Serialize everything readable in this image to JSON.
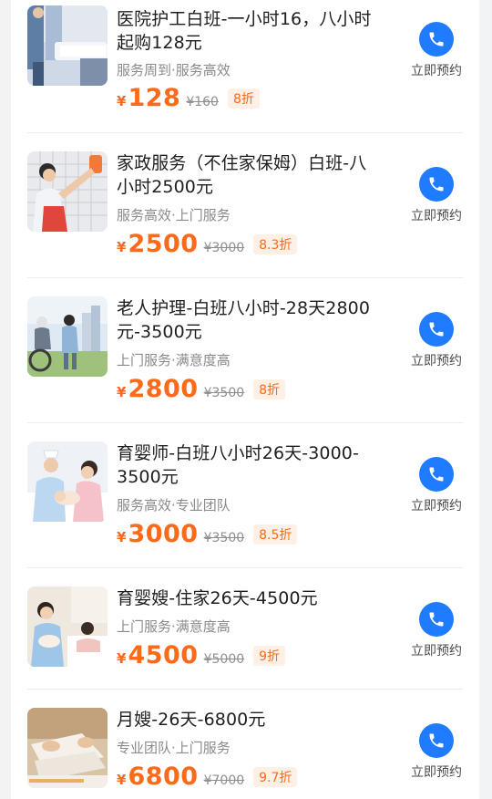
{
  "services": [
    {
      "title": "医院护工白班-一小时16，八小时起购128元",
      "tags": "服务周到·服务高效",
      "currency": "¥",
      "price": "128",
      "original_price": "¥160",
      "discount": "8折",
      "book_label": "立即预约",
      "thumb_icon": "hospital-bed-thumbnail"
    },
    {
      "title": "家政服务（不住家保姆）白班-八小时2500元",
      "tags": "服务高效·上门服务",
      "currency": "¥",
      "price": "2500",
      "original_price": "¥3000",
      "discount": "8.3折",
      "book_label": "立即预约",
      "thumb_icon": "cleaning-worker-thumbnail"
    },
    {
      "title": "老人护理-白班八小时-28天2800元-3500元",
      "tags": "上门服务·满意度高",
      "currency": "¥",
      "price": "2800",
      "original_price": "¥3500",
      "discount": "8折",
      "book_label": "立即预约",
      "thumb_icon": "elderly-care-thumbnail"
    },
    {
      "title": "育婴师-白班八小时26天-3000-3500元",
      "tags": "服务高效·专业团队",
      "currency": "¥",
      "price": "3000",
      "original_price": "¥3500",
      "discount": "8.5折",
      "book_label": "立即预约",
      "thumb_icon": "nursery-nurse-thumbnail"
    },
    {
      "title": "育婴嫂-住家26天-4500元",
      "tags": "上门服务·满意度高",
      "currency": "¥",
      "price": "4500",
      "original_price": "¥5000",
      "discount": "9折",
      "book_label": "立即预约",
      "thumb_icon": "maternity-caregiver-thumbnail"
    },
    {
      "title": "月嫂-26天-6800元",
      "tags": "专业团队·上门服务",
      "currency": "¥",
      "price": "6800",
      "original_price": "¥7000",
      "discount": "9.7折",
      "book_label": "立即预约",
      "thumb_icon": "folding-clothes-thumbnail"
    }
  ],
  "colors": {
    "accent": "#ff6a1a",
    "button_blue": "#1f7bff",
    "discount_bg": "#fff0e6"
  }
}
